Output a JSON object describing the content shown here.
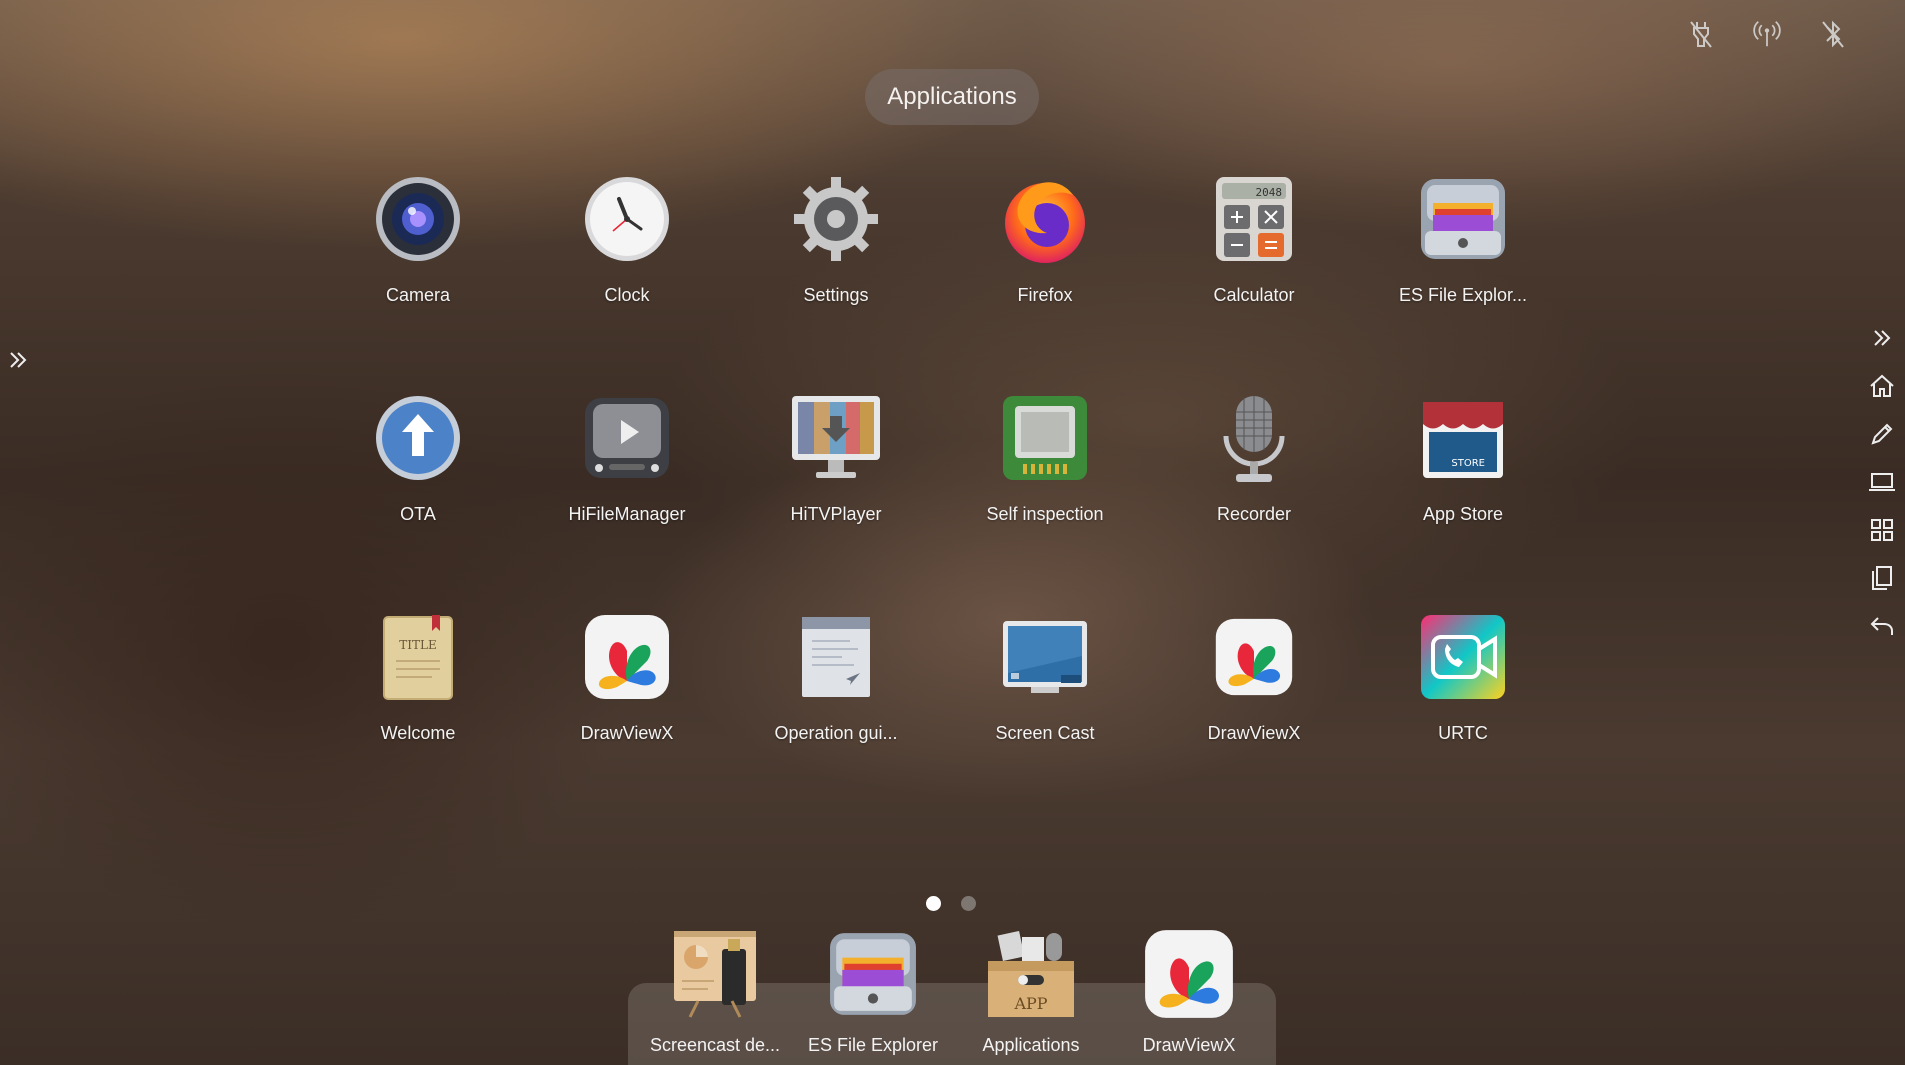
{
  "header": {
    "title": "Applications"
  },
  "status_icons": [
    "ethernet-off-icon",
    "hotspot-icon",
    "bluetooth-off-icon"
  ],
  "apps": [
    {
      "label": "Camera",
      "icon": "camera-icon"
    },
    {
      "label": "Clock",
      "icon": "clock-icon"
    },
    {
      "label": "Settings",
      "icon": "settings-gear-icon"
    },
    {
      "label": "Firefox",
      "icon": "firefox-icon"
    },
    {
      "label": "Calculator",
      "icon": "calculator-icon"
    },
    {
      "label": "ES File Explor...",
      "icon": "es-file-explorer-icon"
    },
    {
      "label": "OTA",
      "icon": "ota-upload-icon"
    },
    {
      "label": "HiFileManager",
      "icon": "file-manager-tv-icon"
    },
    {
      "label": "HiTVPlayer",
      "icon": "tv-player-icon"
    },
    {
      "label": "Self inspection",
      "icon": "self-inspection-chip-icon"
    },
    {
      "label": "Recorder",
      "icon": "microphone-icon"
    },
    {
      "label": "App Store",
      "icon": "store-icon"
    },
    {
      "label": "Welcome",
      "icon": "welcome-book-icon"
    },
    {
      "label": "DrawViewX",
      "icon": "drawviewx-icon"
    },
    {
      "label": "Operation gui...",
      "icon": "operation-guide-icon"
    },
    {
      "label": "Screen Cast",
      "icon": "screen-cast-icon"
    },
    {
      "label": "DrawViewX",
      "icon": "drawviewx-icon"
    },
    {
      "label": "URTC",
      "icon": "urtc-video-call-icon"
    }
  ],
  "side_bar": [
    "expand-icon",
    "home-icon",
    "pen-icon",
    "laptop-icon",
    "apps-grid-icon",
    "multi-window-icon",
    "back-icon"
  ],
  "pagination": {
    "pages": 2,
    "current": 1
  },
  "dock": [
    {
      "label": "Screencast de...",
      "icon": "screencast-device-icon"
    },
    {
      "label": "ES File Explorer",
      "icon": "es-file-explorer-icon"
    },
    {
      "label": "Applications",
      "icon": "applications-box-icon"
    },
    {
      "label": "DrawViewX",
      "icon": "drawviewx-icon"
    }
  ],
  "icon_labels": {
    "calculator_display": "2048",
    "app_store_sign": "STORE",
    "welcome_title": "TITLE",
    "applications_box": "APP"
  }
}
